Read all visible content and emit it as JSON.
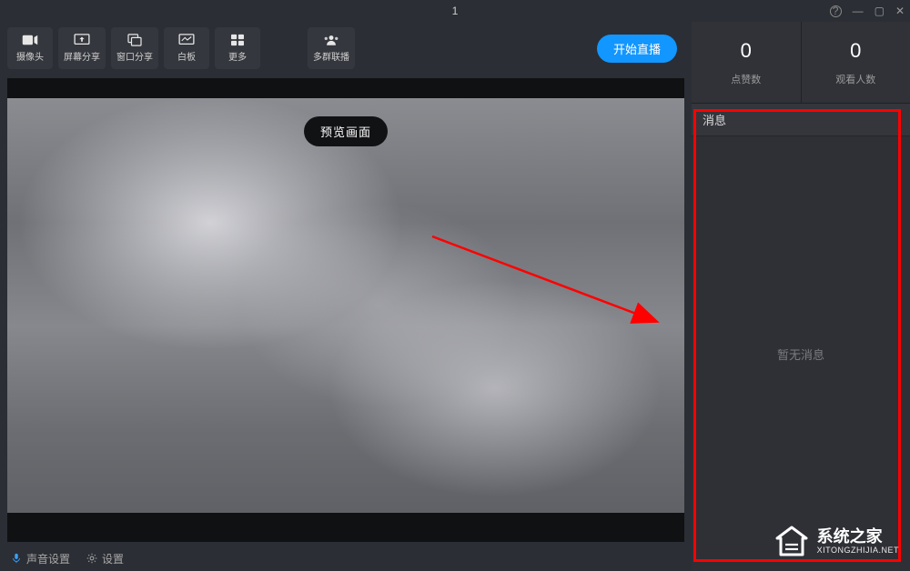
{
  "title": "1",
  "toolbar": {
    "camera": "摄像头",
    "screen_share": "屏幕分享",
    "window_share": "窗口分享",
    "whiteboard": "白板",
    "more": "更多",
    "multi_group": "多群联播",
    "start_live": "开始直播"
  },
  "preview_badge": "预览画面",
  "bottom": {
    "sound_settings": "声音设置",
    "settings": "设置"
  },
  "stats": {
    "likes_count": "0",
    "likes_label": "点赞数",
    "viewers_count": "0",
    "viewers_label": "观看人数"
  },
  "messages": {
    "header": "消息",
    "empty": "暂无消息"
  },
  "watermark": {
    "cn": "系统之家",
    "en": "XITONGZHIJIA.NET"
  }
}
